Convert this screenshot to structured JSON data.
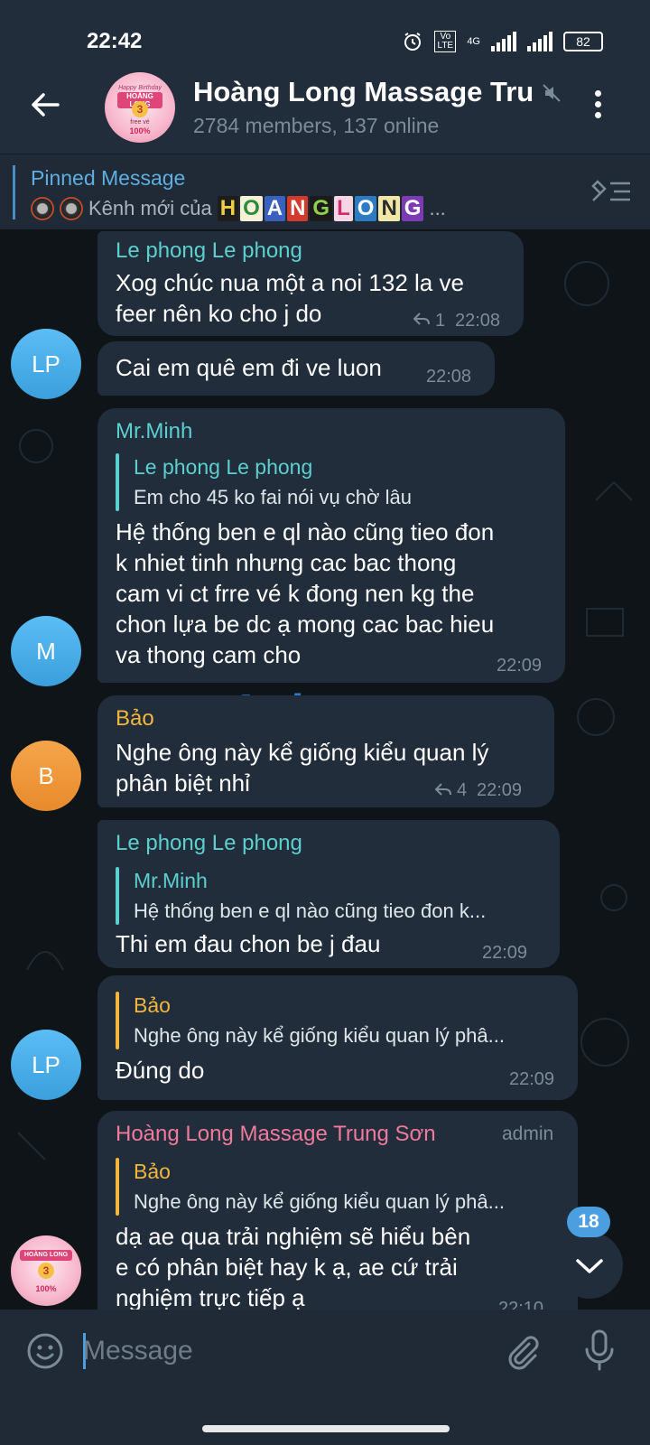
{
  "status_bar": {
    "time": "22:42",
    "network": "4G",
    "volte": "Vo LTE",
    "battery": "82"
  },
  "header": {
    "title": "Hoàng Long Massage Tru",
    "subtitle": "2784 members, 137 online",
    "avatar_text": {
      "line1": "Happy Birthday",
      "line2": "HOÀNG LONG",
      "line3": "3",
      "line4": "free vé",
      "line5": "100%"
    }
  },
  "pinned": {
    "title": "Pinned Message",
    "text": "Kênh mới của",
    "brand_letters": [
      "H",
      "O",
      "A",
      "N",
      "G",
      "L",
      "O",
      "N",
      "G"
    ],
    "ellipsis": "..."
  },
  "messages": [
    {
      "sender": "Le phong Le phong",
      "text_lines": [
        "Xog chúc nua một a noi 132 la ve",
        "feer nên ko cho j do"
      ],
      "replies": "1",
      "time": "22:08"
    },
    {
      "text_lines": [
        "Cai em quê em đi ve luon"
      ],
      "time": "22:08",
      "avatar": "LP"
    },
    {
      "sender": "Mr.Minh",
      "reply_name": "Le phong Le phong",
      "reply_text": "Em cho 45 ko fai nói vụ chờ lâu",
      "text_lines": [
        "Hệ thống ben e ql nào cũng tieo đon",
        "k nhiet tinh nhưng cac bac thong",
        "cam vi ct frre vé k đong nen kg the",
        "chon lựa be dc ạ mong cac bac hieu",
        "va thong cam cho"
      ],
      "time": "22:09",
      "avatar": "M"
    },
    {
      "sender": "Bảo",
      "text_lines": [
        "Nghe ông này kể giống kiểu quan lý",
        "phân biệt nhỉ"
      ],
      "replies": "4",
      "time": "22:09",
      "avatar": "B"
    },
    {
      "sender": "Le phong Le phong",
      "reply_name": "Mr.Minh",
      "reply_text": "Hệ thống ben e ql nào cũng tieo đon k...",
      "text_lines": [
        "Thi em đau chon be j đau"
      ],
      "time": "22:09"
    },
    {
      "reply_name": "Bảo",
      "reply_text": "Nghe ông này kể giống kiểu quan lý phâ...",
      "text_lines": [
        "Đúng do"
      ],
      "time": "22:09",
      "avatar": "LP"
    },
    {
      "sender": "Hoàng Long Massage Trung Sơn",
      "admin": "admin",
      "reply_name": "Bảo",
      "reply_text": "Nghe ông này kể giống kiểu quan lý phâ...",
      "text_lines": [
        "dạ ae qua trải nghiệm sẽ hiểu bên",
        "e có phân biệt hay k ạ, ae cứ trải",
        "nghiệm trực tiếp ạ"
      ],
      "time": "22:10"
    }
  ],
  "watermark": {
    "part1": "Aphang",
    "part2": "x"
  },
  "scroll": {
    "unread_count": "18"
  },
  "input": {
    "placeholder": "Message"
  },
  "colors": {
    "background": "#0f1418",
    "bubble": "#212d3b",
    "header": "#212d3b",
    "accent_blue": "#4b9fe0",
    "name_teal": "#5ccfcf",
    "name_orange": "#f3b63c",
    "name_pink": "#f0799c",
    "meta_gray": "#7c8b98"
  }
}
